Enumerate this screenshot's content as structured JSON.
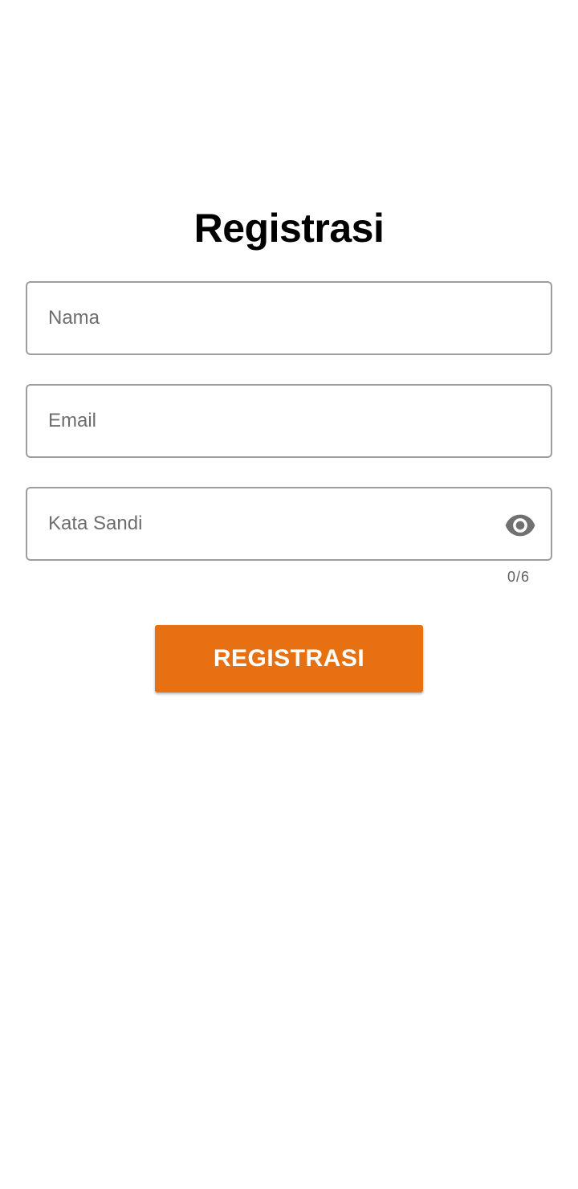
{
  "page": {
    "title": "Registrasi"
  },
  "form": {
    "name_field": {
      "placeholder": "Nama",
      "value": ""
    },
    "email_field": {
      "placeholder": "Email",
      "value": ""
    },
    "password_field": {
      "placeholder": "Kata Sandi",
      "value": "",
      "icon": "eye-icon"
    },
    "password_counter": "0/6",
    "submit_label": "REGISTRASI"
  },
  "colors": {
    "accent": "#e67012",
    "field_border": "#9e9e9e",
    "placeholder": "#6d6d6d",
    "icon": "#707070"
  }
}
